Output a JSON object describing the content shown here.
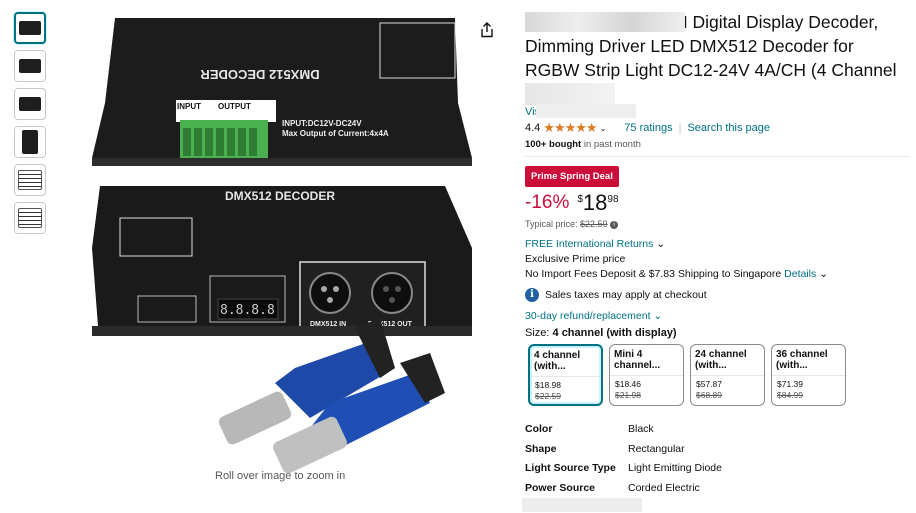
{
  "thumbnails": [
    {
      "name": "thumb-1",
      "active": true
    },
    {
      "name": "thumb-2",
      "active": false
    },
    {
      "name": "thumb-3",
      "active": false
    },
    {
      "name": "thumb-4",
      "active": false
    },
    {
      "name": "thumb-5",
      "active": false
    },
    {
      "name": "thumb-6",
      "active": false
    }
  ],
  "image": {
    "top_decoder_label": "DMX512 DECODER",
    "input_header": "INPUT",
    "output_header": "OUTPUT",
    "input_spec": "INPUT:DC12V-DC24V",
    "output_spec": "Max Output of Current:4x4A",
    "bottom_decoder_label": "DMX512 DECODER",
    "dmx_in_label": "DMX512 IN",
    "dmx_out_label": "DMX512 OUT",
    "zoom_hint": "Roll over image to zoom in"
  },
  "product": {
    "title_line1": "H Digital Display Decoder,",
    "title_line2": "Dimming Driver LED DMX512 Decoder for",
    "title_line3": "RGBW Strip Light DC12-24V 4A/CH (4 Channel",
    "visit_prefix": "Vis",
    "rating_value": "4.4",
    "stars": "★★★★★",
    "ratings_count": "75 ratings",
    "search_page": "Search this page",
    "bought_bold": "100+ bought",
    "bought_rest": " in past month",
    "deal_badge": "Prime Spring Deal",
    "discount": "-16%",
    "currency": "$",
    "price_whole": "18",
    "price_fraction": "98",
    "typical_label": "Typical price: ",
    "typical_price": "$22.59",
    "returns": "FREE International Returns",
    "exclusive": "Exclusive Prime price",
    "shipping_text": "No Import Fees Deposit & $7.83 Shipping to Singapore",
    "shipping_details": "Details",
    "tax_note": "Sales taxes may apply at checkout",
    "refund": "30-day refund/replacement",
    "size_label": "Size: ",
    "size_value": "4 channel (with display)"
  },
  "variants": [
    {
      "name": "4 channel (with...",
      "price": "$18.98",
      "old_price": "$22.59",
      "selected": true
    },
    {
      "name": "Mini 4 channel...",
      "price": "$18.46",
      "old_price": "$21.98",
      "selected": false
    },
    {
      "name": "24 channel (with...",
      "price": "$57.87",
      "old_price": "$68.89",
      "selected": false
    },
    {
      "name": "36 channel (with...",
      "price": "$71.39",
      "old_price": "$84.99",
      "selected": false
    }
  ],
  "specs": [
    {
      "key": "Color",
      "value": "Black"
    },
    {
      "key": "Shape",
      "value": "Rectangular"
    },
    {
      "key": "Light Source Type",
      "value": "Light Emitting Diode"
    },
    {
      "key": "Power Source",
      "value": "Corded Electric"
    }
  ],
  "colors": {
    "link": "#007185",
    "deal_red": "#cc0c39",
    "star_orange": "#de7921",
    "selected_border": "#007185"
  },
  "icons": [
    "share-icon",
    "info-icon",
    "chevron-down-icon",
    "star-icon"
  ]
}
